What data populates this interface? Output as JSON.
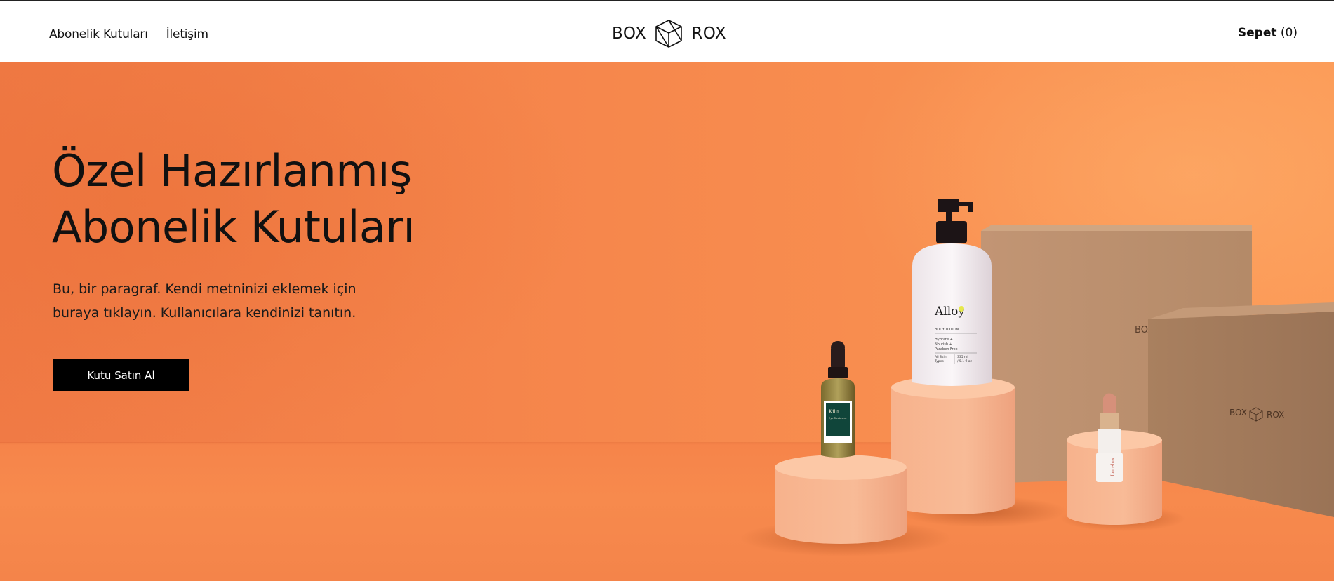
{
  "header": {
    "nav": [
      "Abonelik Kutuları",
      "İletişim"
    ],
    "logo_left": "BOX",
    "logo_right": "ROX",
    "cart_label": "Sepet",
    "cart_count": "(0)"
  },
  "hero": {
    "title_line1": "Özel Hazırlanmış",
    "title_line2": "Abonelik Kutuları",
    "paragraph": "Bu, bir paragraf. Kendi metninizi eklemek için buraya tıklayın. Kullanıcılara kendinizi tanıtın.",
    "cta": "Kutu Satın Al"
  },
  "products": {
    "lotion_brand": "Alloy",
    "lotion_type": "BODY LOTION",
    "lotion_desc": [
      "Hydrate +",
      "Nourish +",
      "Paraben Free"
    ],
    "lotion_skin": [
      "All Skin",
      "Types"
    ],
    "lotion_volume": [
      "335 ml",
      "/ 5.1 fl oz"
    ],
    "serum_brand": "Kilu",
    "serum_type": "Eye Treatment",
    "lipstick_brand": "Lorelux",
    "box_left": "BOX",
    "box_right": "ROX",
    "box_partial": "BOX"
  },
  "colors": {
    "accent": "#000000",
    "hero_bg": "#f6874c",
    "box": "#b98d6a",
    "pedestal": "#f6b08a"
  }
}
